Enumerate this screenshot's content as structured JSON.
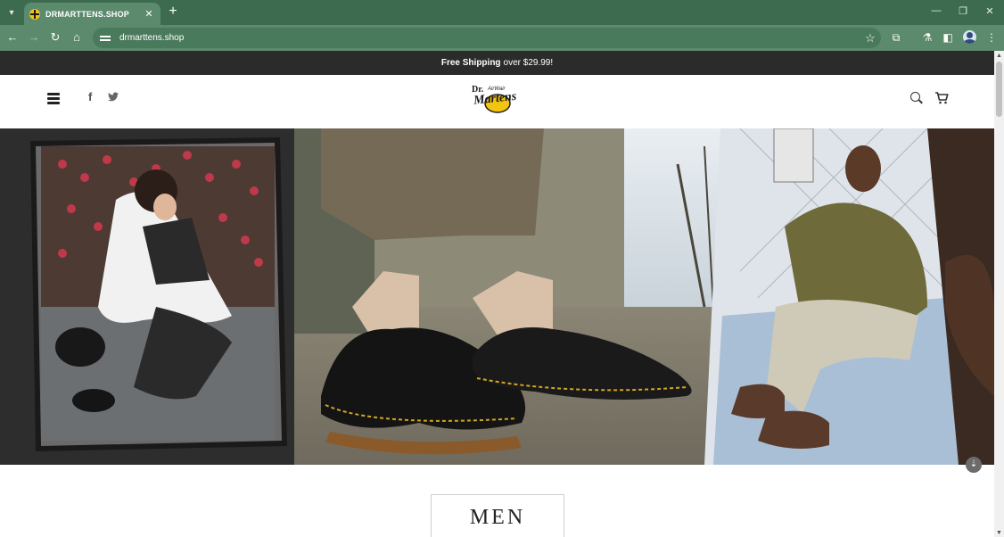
{
  "browser": {
    "tab": {
      "title": "DRMARTTENS.SHOP"
    },
    "address": "drmarttens.shop"
  },
  "site": {
    "announcement": {
      "bold": "Free Shipping",
      "rest": "over $29.99!"
    },
    "logo_text": [
      "Dr.",
      "AirWair",
      "Martens"
    ]
  },
  "category": {
    "label": "MEN"
  },
  "colors": {
    "browser_frame": "#3d6b4f",
    "toolbar": "#5b8a6c",
    "announcement_bar": "#2b2b2b",
    "logo_yellow": "#f2c511"
  }
}
